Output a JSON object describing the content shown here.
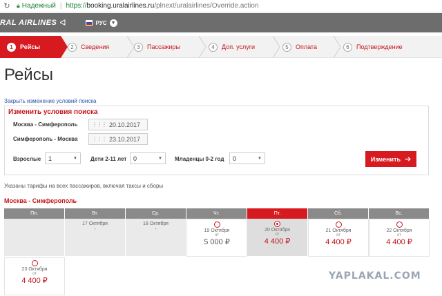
{
  "browser": {
    "reload_icon": "reload-icon",
    "secure_label": "Надежный",
    "url_scheme": "https://",
    "url_host": "booking.uralairlines.ru",
    "url_path": "/plnext/uralairlines/Override.action"
  },
  "header": {
    "logo_text": "RAL AIRLINES",
    "language": "РУС",
    "colors": {
      "bar": "#6d6d6d",
      "accent": "#d71920"
    }
  },
  "steps": [
    {
      "num": "1",
      "label": "Рейсы"
    },
    {
      "num": "2",
      "label": "Сведения"
    },
    {
      "num": "3",
      "label": "Пассажиры"
    },
    {
      "num": "4",
      "label": "Доп. услуги"
    },
    {
      "num": "5",
      "label": "Оплата"
    },
    {
      "num": "6",
      "label": "Подтверждение"
    }
  ],
  "page_title": "Рейсы",
  "close_search_link": "Закрыть изменение условий поиска",
  "search": {
    "title": "Изменить условия поиска",
    "outbound_route": "Москва - Симферополь",
    "outbound_date": "20.10.2017",
    "return_route": "Симферополь - Москва",
    "return_date": "23.10.2017",
    "adults_label": "Взрослые",
    "adults_value": "1",
    "children_label": "Дети 2-11 лет",
    "children_value": "0",
    "infants_label": "Младенцы 0-2 год",
    "infants_value": "0",
    "change_button": "Изменить"
  },
  "fare_note": "Указаны тарифы на всех пассажиров, включая таксы и сборы",
  "calendar": {
    "route": "Москва - Симферополь",
    "weekdays": [
      "Пн.",
      "Вт.",
      "Ср.",
      "Чт.",
      "Пт.",
      "Сб.",
      "Вс."
    ],
    "days": [
      {
        "date": "",
        "status": "empty"
      },
      {
        "date": "17 Октября",
        "dash": "-",
        "status": "past"
      },
      {
        "date": "18 Октября",
        "dash": "-",
        "status": "past"
      },
      {
        "date": "19 Октября",
        "from": "от",
        "price": "5 000 ₽",
        "status": "avail"
      },
      {
        "date": "20 Октября",
        "from": "от",
        "price": "4 400 ₽",
        "status": "selected"
      },
      {
        "date": "21 Октября",
        "from": "от",
        "price": "4 400 ₽",
        "status": "avail"
      },
      {
        "date": "22 Октября",
        "from": "от",
        "price": "4 400 ₽",
        "status": "avail"
      },
      {
        "date": "23 Октября",
        "from": "от",
        "price": "4 400 ₽",
        "status": "avail"
      }
    ]
  },
  "watermark": "YAPLAKAL.COM"
}
